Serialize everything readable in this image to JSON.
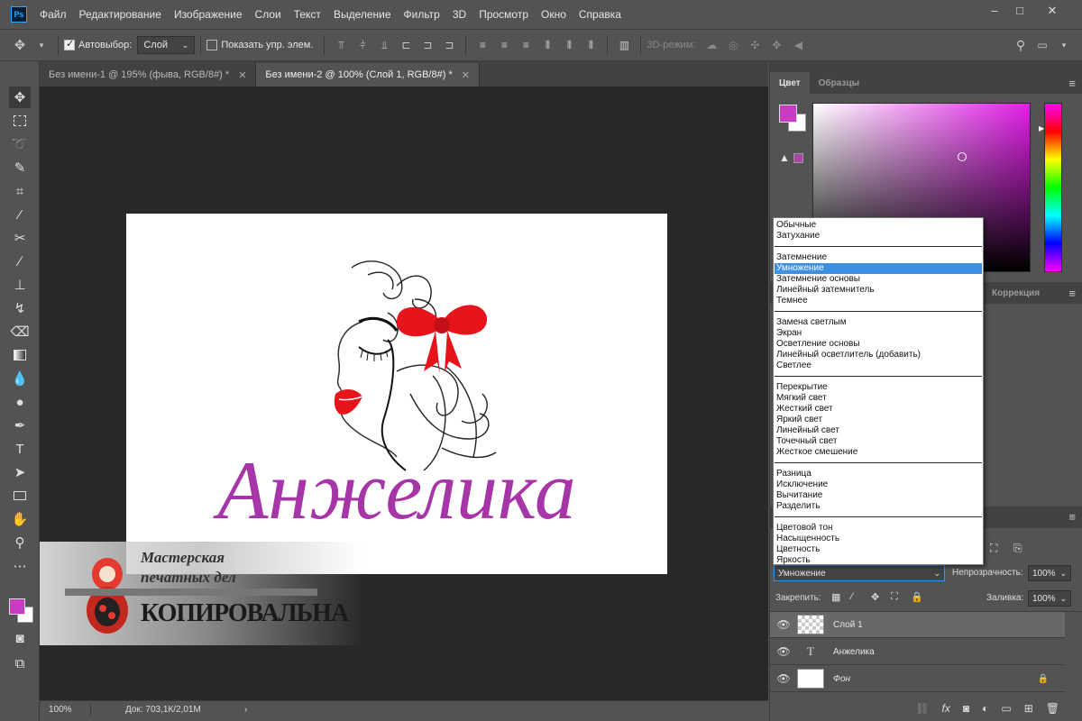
{
  "menubar": {
    "logo": "Ps",
    "items": [
      "Файл",
      "Редактирование",
      "Изображение",
      "Слои",
      "Текст",
      "Выделение",
      "Фильтр",
      "3D",
      "Просмотр",
      "Окно",
      "Справка"
    ],
    "minimize": "–",
    "maximize": "□",
    "close": "✕"
  },
  "options": {
    "autoselect_label": "Автовыбор:",
    "autoselect_value": "Слой",
    "show_controls_label": "Показать упр. элем.",
    "mode3d_label": "3D-режим:"
  },
  "tabs": [
    {
      "label": "Без имени-1 @ 195% (фыва, RGB/8#) *",
      "close": "✕"
    },
    {
      "label": "Без имени-2 @ 100% (Слой 1, RGB/8#) *",
      "close": "✕"
    }
  ],
  "canvas": {
    "name_text": "Анжелика",
    "watermark": {
      "line1": "Мастерская",
      "line2": "печатных дел",
      "line3": "КОПИРОВАЛЬНА"
    }
  },
  "status": {
    "zoom": "100%",
    "doc": "Док: 703,1К/2,01М",
    "arrow": "›"
  },
  "color_panel": {
    "tabs": [
      "Цвет",
      "Образцы"
    ],
    "foreground": "#c83cc3",
    "background": "#ffffff",
    "gamut_color": "#a847a5"
  },
  "adjustments_tab": "Коррекция",
  "blend_modes": {
    "groups": [
      [
        "Обычные",
        "Затухание"
      ],
      [
        "Затемнение",
        "Умножение",
        "Затемнение основы",
        "Линейный затемнитель",
        "Темнее"
      ],
      [
        "Замена светлым",
        "Экран",
        "Осветление основы",
        "Линейный осветлитель (добавить)",
        "Светлее"
      ],
      [
        "Перекрытие",
        "Мягкий свет",
        "Жесткий свет",
        "Яркий свет",
        "Линейный свет",
        "Точечный свет",
        "Жесткое смешение"
      ],
      [
        "Разница",
        "Исключение",
        "Вычитание",
        "Разделить"
      ],
      [
        "Цветовой тон",
        "Насыщенность",
        "Цветность",
        "Яркость"
      ]
    ],
    "selected": "Умножение"
  },
  "layers_panel": {
    "blend_value": "Умножение",
    "opacity_label": "Непрозрачность:",
    "opacity_value": "100%",
    "lock_label": "Закрепить:",
    "fill_label": "Заливка:",
    "fill_value": "100%",
    "layers": [
      {
        "name": "Слой 1",
        "type": "raster",
        "selected": true
      },
      {
        "name": "Анжелика",
        "type": "text",
        "selected": false
      },
      {
        "name": "Фон",
        "type": "background",
        "selected": false
      }
    ]
  }
}
